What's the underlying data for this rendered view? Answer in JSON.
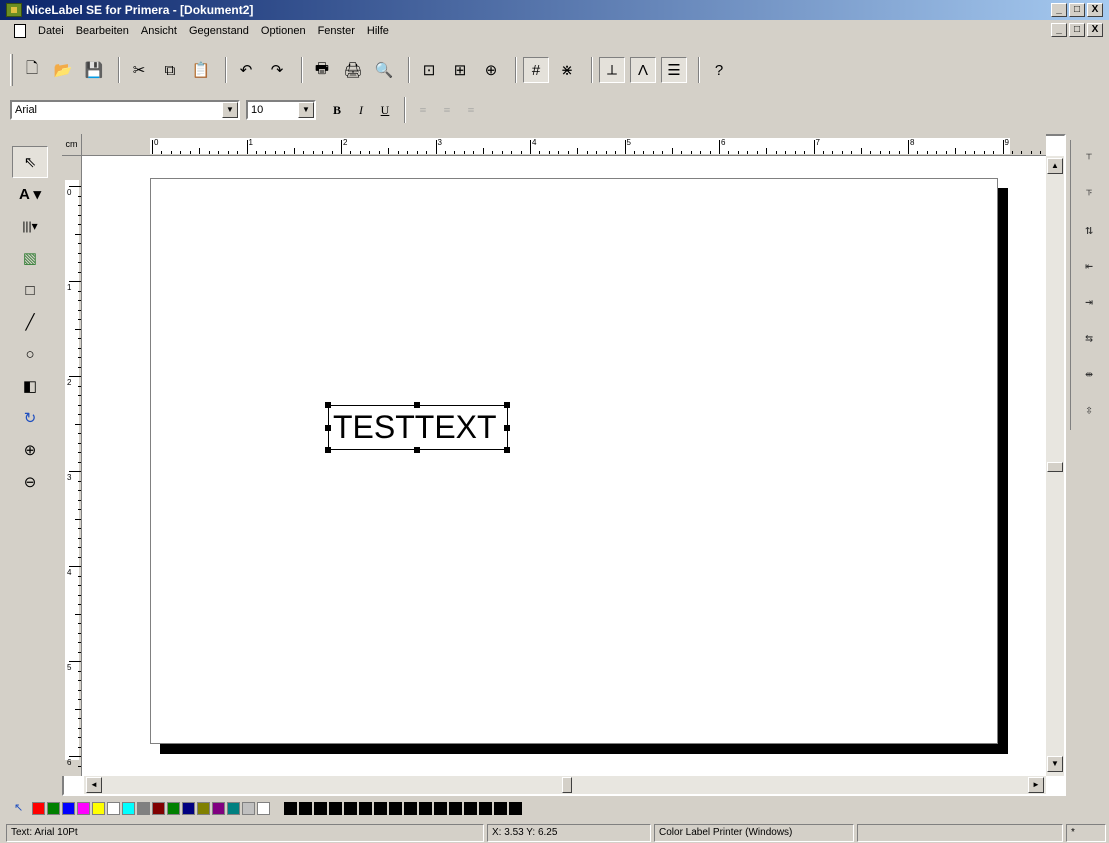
{
  "window": {
    "title": "NiceLabel SE for Primera - [Dokument2]",
    "minimize_glyph": "_",
    "restore_glyph": "□",
    "close_glyph": "X"
  },
  "menu": {
    "items": [
      "Datei",
      "Bearbeiten",
      "Ansicht",
      "Gegenstand",
      "Optionen",
      "Fenster",
      "Hilfe"
    ]
  },
  "toolbar": {
    "buttons": [
      {
        "name": "new-icon",
        "glyph": "🗋"
      },
      {
        "name": "open-icon",
        "glyph": "📂"
      },
      {
        "name": "save-icon",
        "glyph": "💾"
      },
      {
        "name": "cut-icon",
        "glyph": "✂"
      },
      {
        "name": "copy-icon",
        "glyph": "⧉"
      },
      {
        "name": "paste-icon",
        "glyph": "📋"
      },
      {
        "name": "undo-icon",
        "glyph": "↶"
      },
      {
        "name": "redo-icon",
        "glyph": "↷"
      },
      {
        "name": "print-icon",
        "glyph": "🖶"
      },
      {
        "name": "print-setup-icon",
        "glyph": "🖨"
      },
      {
        "name": "print-preview-icon",
        "glyph": "🔍"
      },
      {
        "name": "zoom-to-label-icon",
        "glyph": "⊡"
      },
      {
        "name": "zoom-window-icon",
        "glyph": "⊞"
      },
      {
        "name": "zoom-icon",
        "glyph": "⊕"
      },
      {
        "name": "grid-icon",
        "glyph": "#"
      },
      {
        "name": "snap-icon",
        "glyph": "⋇"
      },
      {
        "name": "align-icon",
        "glyph": "⟂"
      },
      {
        "name": "variables-icon",
        "glyph": "Ʌ"
      },
      {
        "name": "database-icon",
        "glyph": "☰"
      },
      {
        "name": "help-icon",
        "glyph": "?"
      }
    ]
  },
  "format": {
    "font_name": "Arial",
    "font_size": "10",
    "bold": "B",
    "italic": "I",
    "underline": "U",
    "align_left": "≡",
    "align_center": "≡",
    "align_right": "≡"
  },
  "tools_left": [
    {
      "name": "select-arrow-icon",
      "glyph": "⇖"
    },
    {
      "name": "text-tool-icon",
      "glyph": "A ▾"
    },
    {
      "name": "barcode-tool-icon",
      "glyph": "|||▾"
    },
    {
      "name": "picture-tool-icon",
      "glyph": "▧"
    },
    {
      "name": "rectangle-tool-icon",
      "glyph": "□"
    },
    {
      "name": "line-tool-icon",
      "glyph": "╱"
    },
    {
      "name": "ellipse-tool-icon",
      "glyph": "○"
    },
    {
      "name": "inverse-tool-icon",
      "glyph": "◧"
    },
    {
      "name": "rotate-tool-icon",
      "glyph": "↻"
    },
    {
      "name": "zoom-in-icon",
      "glyph": "⊕"
    },
    {
      "name": "zoom-out-icon",
      "glyph": "⊖"
    }
  ],
  "tools_right": [
    {
      "name": "align-top-icon",
      "glyph": "⸆"
    },
    {
      "name": "align-bottom-icon",
      "glyph": "⸇"
    },
    {
      "name": "center-vertical-icon",
      "glyph": "⇅"
    },
    {
      "name": "align-left-icon",
      "glyph": "⇤"
    },
    {
      "name": "align-right-icon",
      "glyph": "⇥"
    },
    {
      "name": "center-horizontal-icon",
      "glyph": "⇆"
    },
    {
      "name": "space-horizontal-icon",
      "glyph": "⇹"
    },
    {
      "name": "space-vertical-icon",
      "glyph": "⇳"
    }
  ],
  "ruler": {
    "unit": "cm",
    "h_labels": [
      "0",
      "1",
      "2",
      "3",
      "4",
      "5",
      "6",
      "7",
      "8",
      "9"
    ],
    "v_labels": [
      "0",
      "1",
      "2",
      "3",
      "4",
      "5",
      "6"
    ]
  },
  "canvas": {
    "text_object": "TESTTEXT"
  },
  "palette": {
    "colors": [
      "#ff0000",
      "#008000",
      "#0000ff",
      "#ff00ff",
      "#ffff00",
      "#ffffff",
      "#00ffff",
      "#808080",
      "#800000",
      "#008000",
      "#000080",
      "#808000",
      "#800080",
      "#008080",
      "#c0c0c0",
      "#ffffff"
    ],
    "black_count": 16
  },
  "status": {
    "text_info": "Text: Arial 10Pt",
    "coords": "X:  3.53 Y:  6.25",
    "printer": "Color Label Printer (Windows)",
    "extra": "*"
  },
  "scroll": {
    "up": "▲",
    "down": "▼",
    "left": "◄",
    "right": "►"
  }
}
